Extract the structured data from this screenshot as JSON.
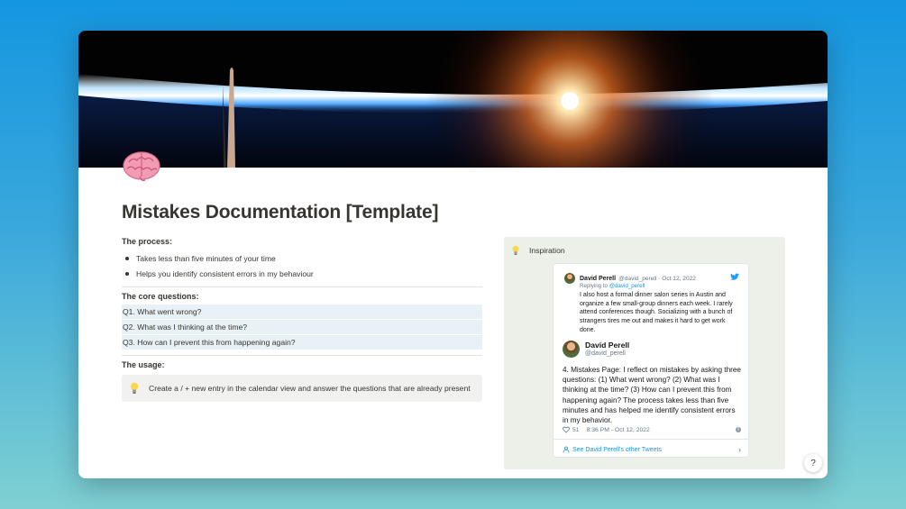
{
  "page": {
    "title": "Mistakes Documentation [Template]",
    "icon": "brain-icon"
  },
  "process": {
    "heading": "The process:",
    "items": [
      "Takes less than five minutes  of your time",
      "Helps you identify consistent errors in my behaviour"
    ]
  },
  "core": {
    "heading": "The core questions:",
    "questions": [
      "Q1.  What went wrong?",
      "Q2. What was I thinking at the time?",
      "Q3. How can I prevent this from happening again?"
    ]
  },
  "usage": {
    "heading": "The usage:",
    "callout_icon": "lightbulb-icon",
    "callout_text": "Create a / + new entry in the calendar view and answer the questions that are already present"
  },
  "inspiration": {
    "heading": "Inspiration",
    "icon": "lightbulb-icon",
    "tweet": {
      "reply": {
        "name": "David Perell",
        "meta": "@david_perell · Oct 12, 2022",
        "replying_prefix": "Replying to ",
        "replying_handle": "@david_perell",
        "text": "I also host a formal dinner salon series in Austin and organize a few small-group dinners each week. I rarely attend conferences though. Socializing with a bunch of strangers tires me out and makes it hard to get work done."
      },
      "main": {
        "name": "David Perell",
        "handle": "@david_perell",
        "text": "4. Mistakes Page: I reflect on mistakes by asking three questions: (1) What went wrong? (2) What was I thinking at the time? (3) How can I prevent this from happening again? The process takes less than five minutes and has helped me identify consistent errors in my behavior.",
        "likes": "51",
        "time": "8:36 PM - Oct 12, 2022"
      },
      "see_more": "See David Perell's other Tweets"
    }
  },
  "help": {
    "label": "?"
  },
  "colors": {
    "background_top": "#1596e0",
    "background_bottom": "#7fd0d2",
    "question_highlight": "#e7f1f6",
    "callout_bg": "#f1f1ef",
    "panel_bg": "#ecf0e9",
    "twitter_blue": "#1b95e0"
  }
}
